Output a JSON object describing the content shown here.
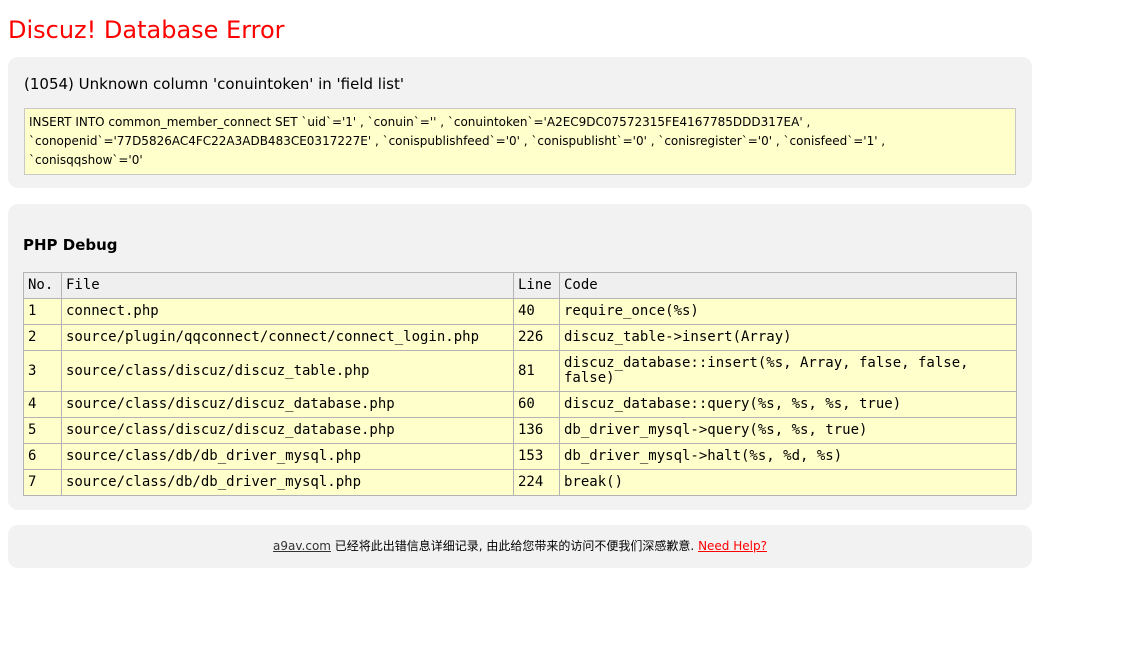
{
  "page": {
    "title": "Discuz! Database Error"
  },
  "error": {
    "message": "(1054) Unknown column 'conuintoken' in 'field list'",
    "sql_lines": [
      "INSERT INTO common_member_connect SET `uid`='1' , `conuin`='' , `conuintoken`='A2EC9DC07572315FE4167785DDD317EA' ,",
      "`conopenid`='77D5826AC4FC22A3ADB483CE0317227E' , `conispublishfeed`='0' , `conispublisht`='0' , `conisregister`='0' , `conisfeed`='1' ,",
      "`conisqqshow`='0'"
    ]
  },
  "debug": {
    "title": "PHP Debug",
    "columns": [
      "No.",
      "File",
      "Line",
      "Code"
    ],
    "rows": [
      {
        "no": "1",
        "file": "connect.php",
        "line": "40",
        "code": "require_once(%s)"
      },
      {
        "no": "2",
        "file": "source/plugin/qqconnect/connect/connect_login.php",
        "line": "226",
        "code": "discuz_table->insert(Array)"
      },
      {
        "no": "3",
        "file": "source/class/discuz/discuz_table.php",
        "line": "81",
        "code": "discuz_database::insert(%s, Array, false, false, false)"
      },
      {
        "no": "4",
        "file": "source/class/discuz/discuz_database.php",
        "line": "60",
        "code": "discuz_database::query(%s, %s, %s, true)"
      },
      {
        "no": "5",
        "file": "source/class/discuz/discuz_database.php",
        "line": "136",
        "code": "db_driver_mysql->query(%s, %s, true)"
      },
      {
        "no": "6",
        "file": "source/class/db/db_driver_mysql.php",
        "line": "153",
        "code": "db_driver_mysql->halt(%s, %d, %s)"
      },
      {
        "no": "7",
        "file": "source/class/db/db_driver_mysql.php",
        "line": "224",
        "code": "break()"
      }
    ]
  },
  "footer": {
    "site_link": "a9av.com",
    "notice": " 已经将此出错信息详细记录, 由此给您带来的访问不便我们深感歉意. ",
    "help_link": "Need Help?",
    "colors": {
      "link": "#333333",
      "help": "#ff0000"
    }
  },
  "colors": {
    "title": "#ff0000",
    "panel": "#f2f2f2",
    "highlight": "#ffffcc"
  }
}
